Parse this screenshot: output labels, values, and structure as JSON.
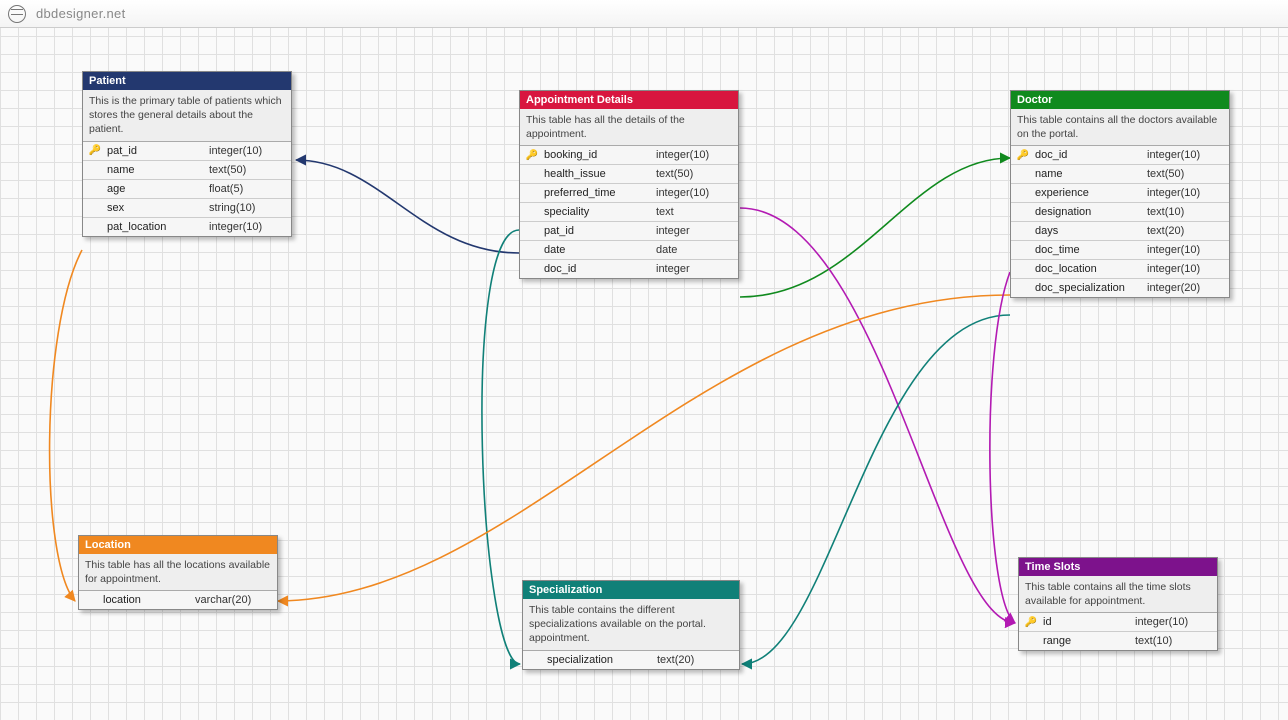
{
  "brand": "dbdesigner.net",
  "tables": {
    "patient": {
      "title": "Patient",
      "desc": "This is the primary table of patients which stores the general details about the patient.",
      "cols": [
        {
          "key": true,
          "name": "pat_id",
          "type": "integer(10)"
        },
        {
          "key": false,
          "name": "name",
          "type": "text(50)"
        },
        {
          "key": false,
          "name": "age",
          "type": "float(5)"
        },
        {
          "key": false,
          "name": "sex",
          "type": "string(10)"
        },
        {
          "key": false,
          "name": "pat_location",
          "type": "integer(10)"
        }
      ]
    },
    "appointment": {
      "title": "Appointment Details",
      "desc": "This table has all the details of the appointment.",
      "cols": [
        {
          "key": true,
          "name": "booking_id",
          "type": "integer(10)"
        },
        {
          "key": false,
          "name": "health_issue",
          "type": "text(50)"
        },
        {
          "key": false,
          "name": "preferred_time",
          "type": "integer(10)"
        },
        {
          "key": false,
          "name": "speciality",
          "type": "text"
        },
        {
          "key": false,
          "name": "pat_id",
          "type": "integer"
        },
        {
          "key": false,
          "name": "date",
          "type": "date"
        },
        {
          "key": false,
          "name": "doc_id",
          "type": "integer"
        }
      ]
    },
    "doctor": {
      "title": "Doctor",
      "desc": "This table contains all the doctors available on the portal.",
      "cols": [
        {
          "key": true,
          "name": "doc_id",
          "type": "integer(10)"
        },
        {
          "key": false,
          "name": "name",
          "type": "text(50)"
        },
        {
          "key": false,
          "name": "experience",
          "type": "integer(10)"
        },
        {
          "key": false,
          "name": "designation",
          "type": "text(10)"
        },
        {
          "key": false,
          "name": "days",
          "type": "text(20)"
        },
        {
          "key": false,
          "name": "doc_time",
          "type": "integer(10)"
        },
        {
          "key": false,
          "name": "doc_location",
          "type": "integer(10)"
        },
        {
          "key": false,
          "name": "doc_specialization",
          "type": "integer(20)"
        }
      ]
    },
    "location": {
      "title": "Location",
      "desc": "This table has all the locations available for appointment.",
      "cols": [
        {
          "key": false,
          "name": "location",
          "type": "varchar(20)"
        }
      ]
    },
    "specialization": {
      "title": "Specialization",
      "desc": "This table contains the different specializations available on the portal. appointment.",
      "cols": [
        {
          "key": false,
          "name": "specialization",
          "type": "text(20)"
        }
      ]
    },
    "timeslots": {
      "title": "Time Slots",
      "desc": "This table contains all the time slots available for appointment.",
      "cols": [
        {
          "key": true,
          "name": "id",
          "type": "integer(10)"
        },
        {
          "key": false,
          "name": "range",
          "type": "text(10)"
        }
      ]
    }
  },
  "relationships": [
    {
      "from": "appointment.pat_id",
      "to": "patient.pat_id",
      "color": "#23386f"
    },
    {
      "from": "appointment.doc_id",
      "to": "doctor.doc_id",
      "color": "#108a1e"
    },
    {
      "from": "appointment.preferred_time",
      "to": "timeslots.id",
      "color": "#b31ab3"
    },
    {
      "from": "appointment.speciality",
      "to": "specialization.specialization",
      "color": "#108078"
    },
    {
      "from": "doctor.doc_location",
      "to": "location.location",
      "color": "#f08820"
    },
    {
      "from": "doctor.doc_time",
      "to": "timeslots.id",
      "color": "#b31ab3"
    },
    {
      "from": "doctor.doc_specialization",
      "to": "specialization.specialization",
      "color": "#108078"
    },
    {
      "from": "patient.pat_location",
      "to": "location.location",
      "color": "#f08820"
    }
  ]
}
